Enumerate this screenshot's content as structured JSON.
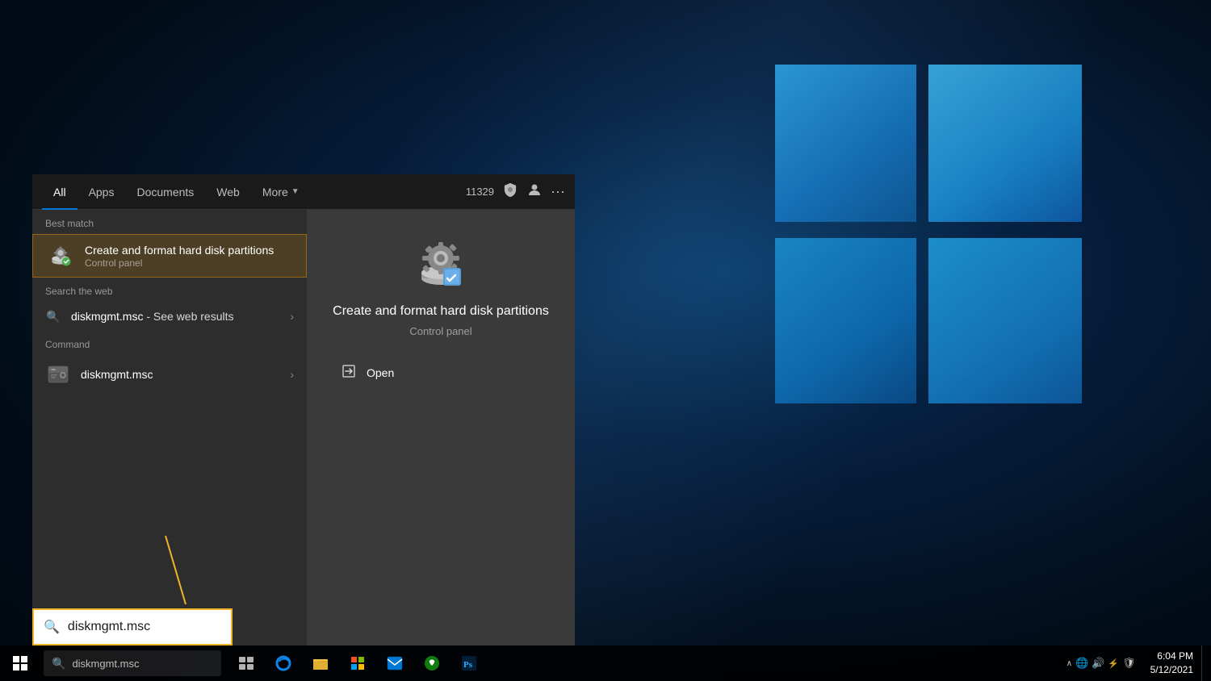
{
  "desktop": {
    "background": "Windows 10 desktop"
  },
  "taskbar": {
    "search_placeholder": "diskmgmt.msc",
    "search_text": "diskmgmt.msc",
    "clock": {
      "time": "6:04 PM",
      "date": "5/12/2021"
    }
  },
  "search_box": {
    "value": "diskmgmt.msc",
    "icon": "🔍"
  },
  "start_menu": {
    "tabs": [
      {
        "label": "All",
        "active": true
      },
      {
        "label": "Apps",
        "active": false
      },
      {
        "label": "Documents",
        "active": false
      },
      {
        "label": "Web",
        "active": false
      },
      {
        "label": "More",
        "active": false,
        "has_arrow": true
      }
    ],
    "topbar_badge": "11329",
    "best_match_label": "Best match",
    "best_match": {
      "name": "Create and format hard disk partitions",
      "sub": "Control panel",
      "selected": true
    },
    "search_web_label": "Search the web",
    "web_search": {
      "query": "diskmgmt.msc",
      "suffix": " - See web results"
    },
    "command_label": "Command",
    "command": {
      "name": "diskmgmt.msc"
    },
    "detail": {
      "title": "Create and format hard disk partitions",
      "sub": "Control panel",
      "open_label": "Open"
    }
  }
}
